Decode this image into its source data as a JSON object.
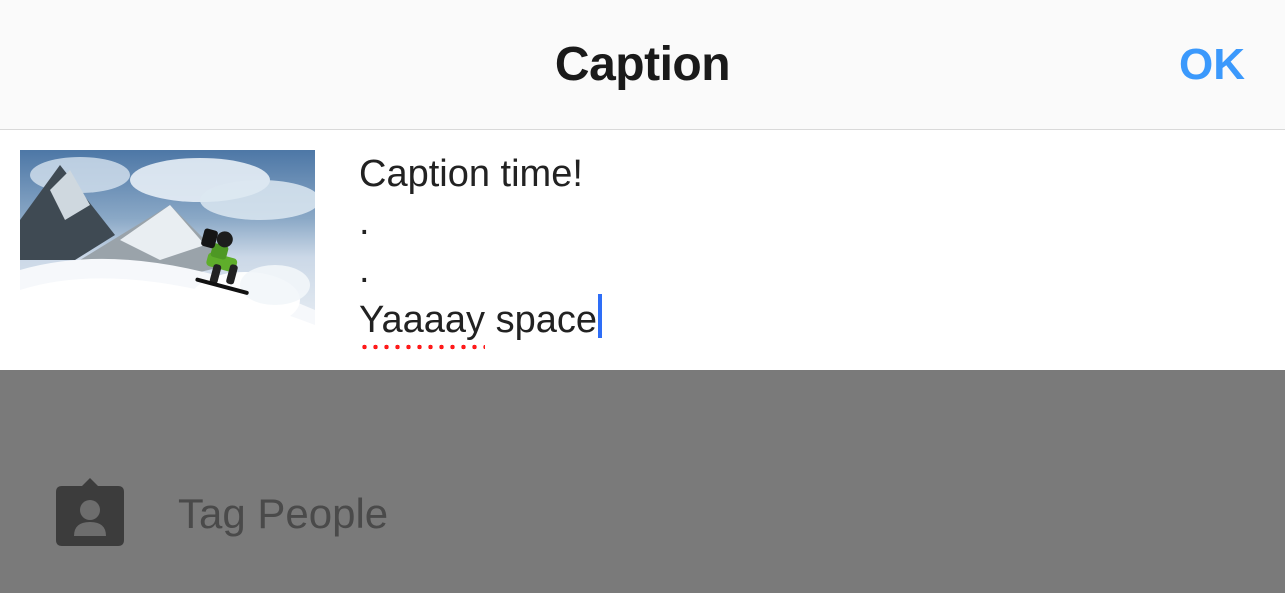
{
  "header": {
    "title": "Caption",
    "ok_label": "OK"
  },
  "caption": {
    "lines": [
      "Caption time!",
      ".",
      ".",
      "Yaaaay space"
    ],
    "spellcheck_word": "Yaaaay",
    "rest_after_spell": " space"
  },
  "tag_row": {
    "label": "Tag People"
  }
}
